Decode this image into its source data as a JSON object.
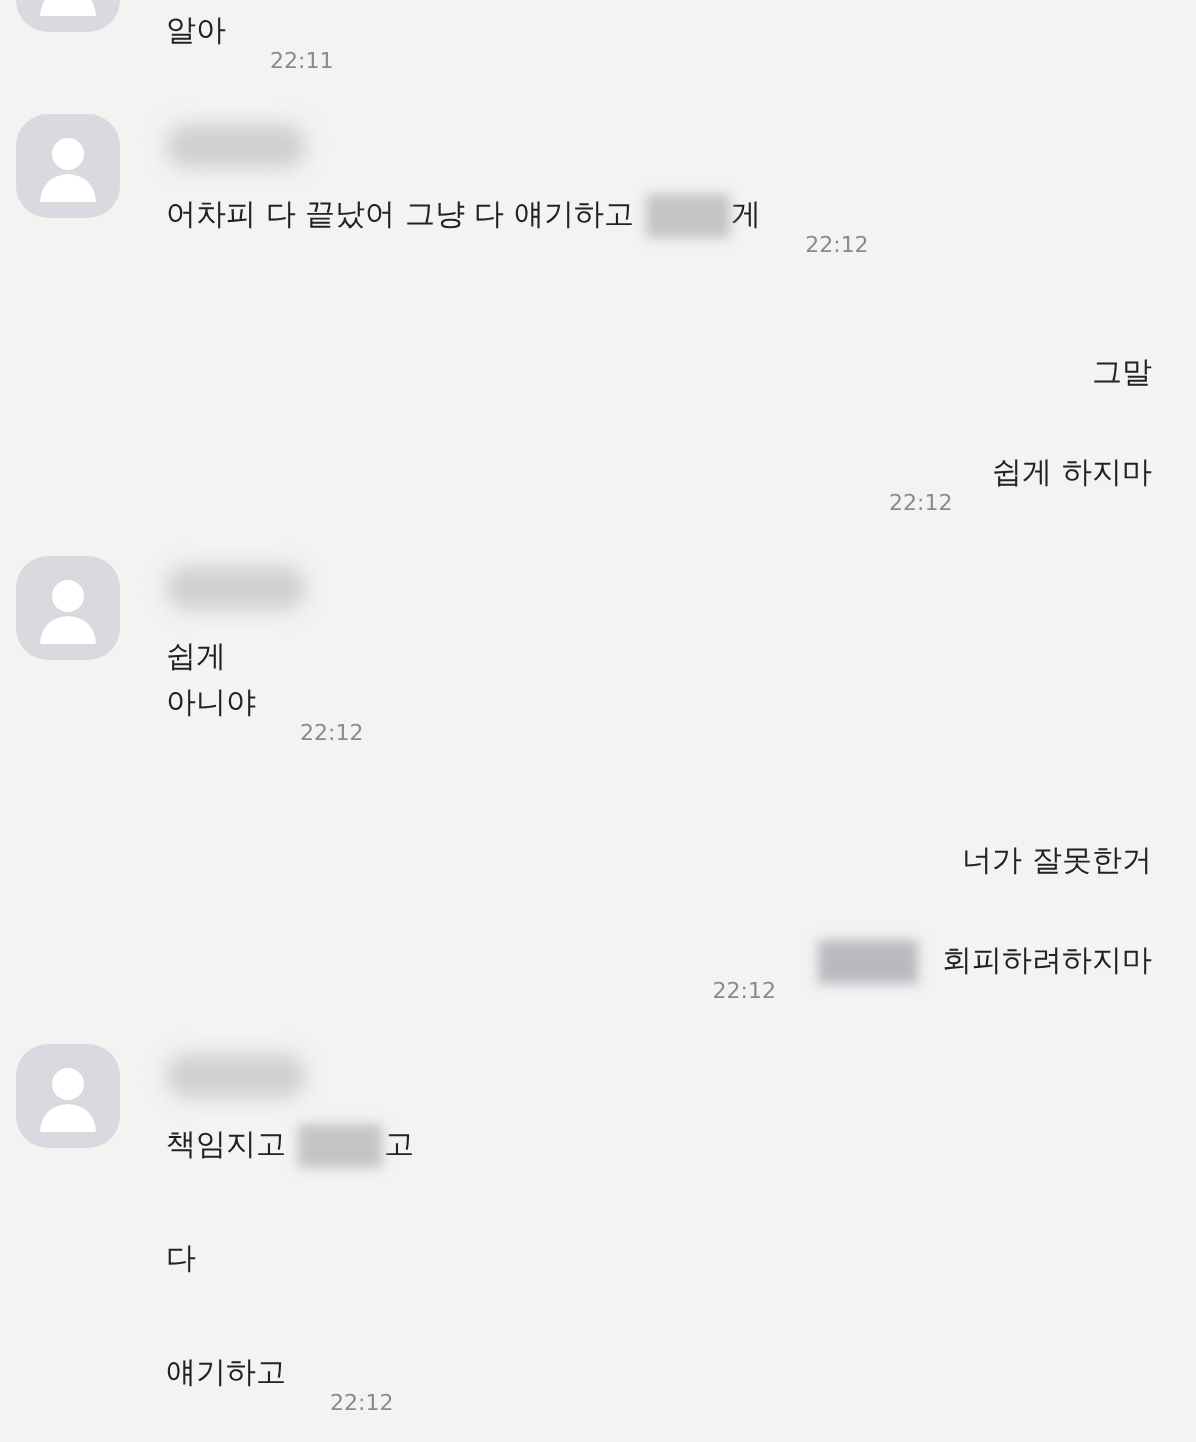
{
  "groups": [
    {
      "kind": "received",
      "clipped": true,
      "name_blurred": false,
      "messages": [
        {
          "parts": [
            {
              "kind": "text",
              "text": "알아"
            }
          ],
          "time": "22:11"
        }
      ]
    },
    {
      "kind": "received",
      "clipped": false,
      "name_blurred": true,
      "messages": [
        {
          "parts": [
            {
              "kind": "text",
              "text": "어차피 다 끝났어 그냥 다 얘기하고 "
            },
            {
              "kind": "blur"
            },
            {
              "kind": "text",
              "text": "게"
            }
          ],
          "time": "22:12"
        }
      ]
    },
    {
      "kind": "sent",
      "messages": [
        {
          "parts": [
            {
              "kind": "text",
              "text": "그말"
            }
          ]
        },
        {
          "parts": [
            {
              "kind": "text",
              "text": "쉽게 하지마"
            }
          ],
          "time": "22:12"
        }
      ]
    },
    {
      "kind": "received",
      "clipped": false,
      "name_blurred": true,
      "messages": [
        {
          "parts": [
            {
              "kind": "text",
              "text": "쉽게\n아니야"
            }
          ],
          "time": "22:12"
        }
      ]
    },
    {
      "kind": "sent",
      "messages": [
        {
          "parts": [
            {
              "kind": "text",
              "text": "너가 잘못한거"
            }
          ]
        },
        {
          "parts": [
            {
              "kind": "blur"
            },
            {
              "kind": "text",
              "text": "회피하려하지마"
            }
          ],
          "time": "22:12"
        }
      ]
    },
    {
      "kind": "received",
      "clipped": false,
      "name_blurred": true,
      "messages": [
        {
          "parts": [
            {
              "kind": "text",
              "text": "책임지고 "
            },
            {
              "kind": "blur"
            },
            {
              "kind": "text",
              "text": "고"
            }
          ]
        },
        {
          "parts": [
            {
              "kind": "text",
              "text": "다"
            }
          ]
        },
        {
          "parts": [
            {
              "kind": "text",
              "text": "얘기하고"
            }
          ],
          "time": "22:12"
        }
      ]
    }
  ]
}
